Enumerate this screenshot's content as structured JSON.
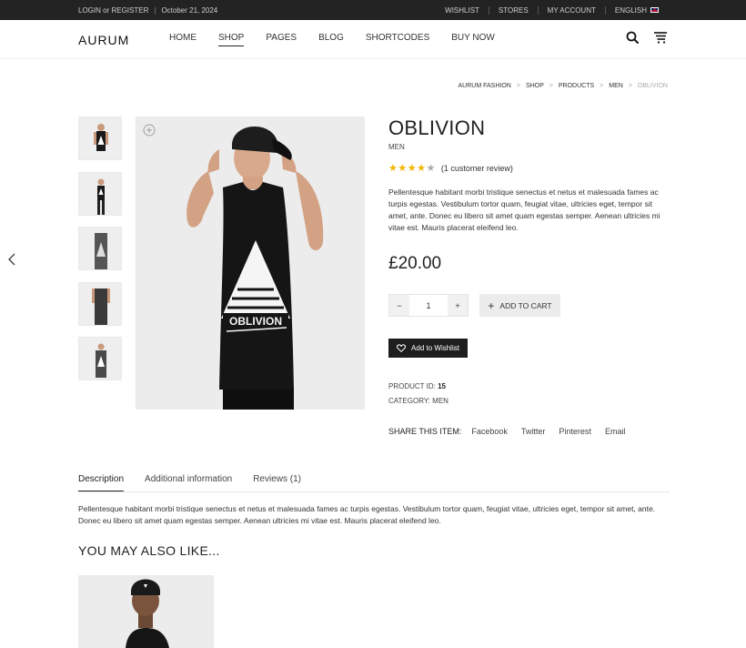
{
  "topbar": {
    "login": "LOGIN or REGISTER",
    "date": "October 21, 2024",
    "links": [
      "WISHLIST",
      "STORES",
      "MY ACCOUNT",
      "ENGLISH"
    ]
  },
  "header": {
    "logo": "AURUM",
    "nav": [
      "HOME",
      "SHOP",
      "PAGES",
      "BLOG",
      "SHORTCODES",
      "BUY NOW"
    ],
    "active_nav": "SHOP"
  },
  "breadcrumb": [
    "AURUM FASHION",
    "SHOP",
    "PRODUCTS",
    "MEN",
    "OBLIVION"
  ],
  "product": {
    "title": "OBLIVION",
    "category": "MEN",
    "rating": 4,
    "rating_max": 5,
    "review_text": "(1 customer review)",
    "description": "Pellentesque habitant morbi tristique senectus et netus et malesuada fames ac turpis egestas. Vestibulum tortor quam, feugiat vitae, ultricies eget, tempor sit amet, ante. Donec eu libero sit amet quam egestas semper. Aenean ultricies mi vitae est. Mauris placerat eleifend leo.",
    "price": "£20.00",
    "quantity": "1",
    "add_to_cart": "ADD TO CART",
    "add_to_wishlist": "Add to Wishlist",
    "product_id_label": "PRODUCT ID:",
    "product_id": "15",
    "category_label": "CATEGORY:",
    "category_value": "MEN",
    "shirt_text": "OBLIVION",
    "share_label": "SHARE THIS ITEM:",
    "share_links": [
      "Facebook",
      "Twitter",
      "Pinterest",
      "Email"
    ]
  },
  "tabs": [
    "Description",
    "Additional information",
    "Reviews (1)"
  ],
  "tab_description": "Pellentesque habitant morbi tristique senectus et netus et malesuada fames ac turpis egestas. Vestibulum tortor quam, feugiat vitae, ultricies eget, tempor sit amet, ante. Donec eu libero sit amet quam egestas semper. Aenean ultricies mi vitae est. Mauris placerat eleifend leo.",
  "related": {
    "title": "YOU MAY ALSO LIKE..."
  },
  "colors": {
    "topbar_bg": "#232323",
    "star": "#f4b400",
    "wishlist_bg": "#1e1e1e"
  },
  "icons": [
    "search-icon",
    "cart-icon",
    "chevron-left-icon",
    "zoom-plus-icon",
    "heart-icon",
    "plus-icon",
    "minus-icon"
  ]
}
